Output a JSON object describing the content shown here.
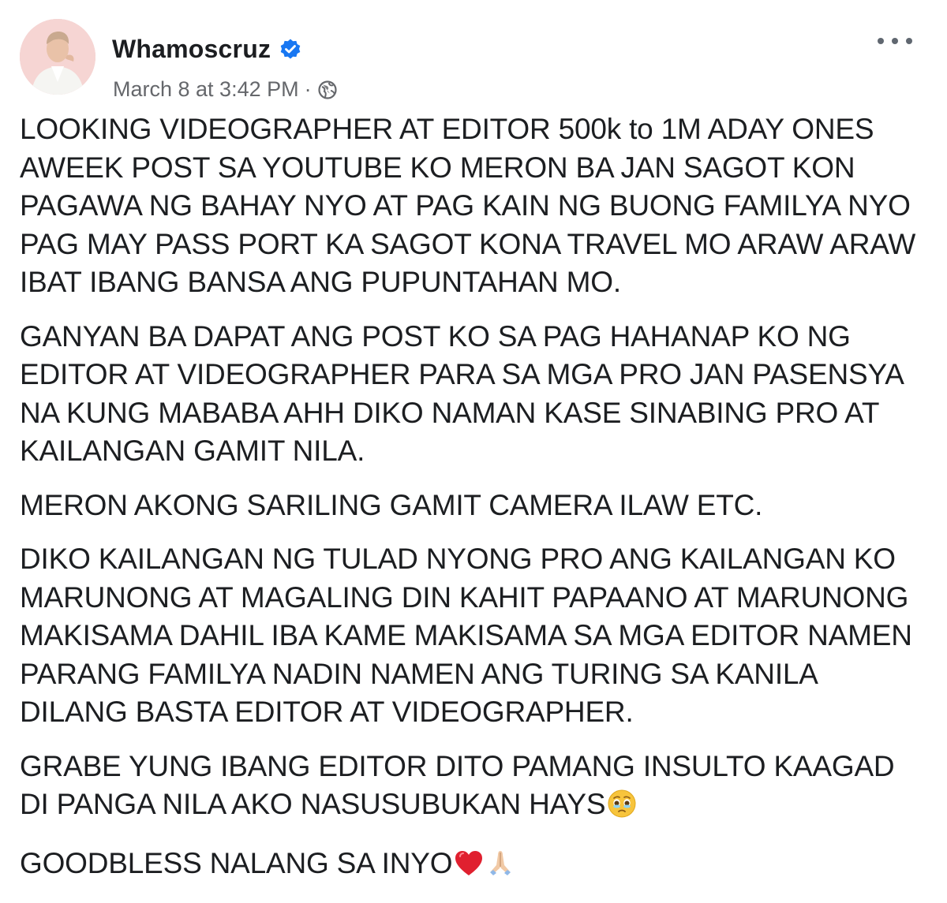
{
  "post": {
    "author": "Whamoscruz",
    "timestamp": "March 8 at 3:42 PM",
    "separator": "·",
    "audience_icon": "globe-icon",
    "verified_icon": "verified-badge-icon",
    "more_icon": "more-options-icon",
    "colors": {
      "verified": "#1877f2",
      "meta_text": "#65676b",
      "body_text": "#1c1e21"
    },
    "paragraphs": [
      "LOOKING VIDEOGRAPHER AT EDITOR 500k to 1M ADAY ONES AWEEK POST SA YOUTUBE KO MERON BA JAN SAGOT KON PAGAWA NG BAHAY NYO AT PAG KAIN NG BUONG FAMILYA NYO PAG MAY PASS PORT KA SAGOT KONA TRAVEL MO ARAW ARAW IBAT IBANG BANSA ANG PUPUNTAHAN MO.",
      "GANYAN BA DAPAT ANG POST KO SA PAG HAHANAP KO NG EDITOR AT VIDEOGRAPHER PARA SA MGA PRO JAN PASENSYA NA KUNG MABABA AHH DIKO NAMAN KASE SINABING PRO AT KAILANGAN GAMIT NILA.",
      "MERON AKONG SARILING GAMIT CAMERA ILAW ETC.",
      "DIKO KAILANGAN NG TULAD NYONG PRO ANG KAILANGAN KO MARUNONG AT MAGALING DIN KAHIT PAPAANO AT MARUNONG MAKISAMA DAHIL IBA KAME MAKISAMA SA MGA EDITOR NAMEN PARANG FAMILYA NADIN NAMEN ANG TURING SA KANILA DILANG BASTA EDITOR AT VIDEOGRAPHER.",
      "GRABE YUNG IBANG EDITOR DITO PAMANG INSULTO KAAGAD DI PANGA NILA AKO NASUSUBUKAN HAYS",
      "GOODBLESS NALANG SA INYO"
    ],
    "emojis": {
      "p5": "teary-face-emoji",
      "p6": [
        "red-heart-emoji",
        "folded-hands-emoji"
      ]
    }
  }
}
